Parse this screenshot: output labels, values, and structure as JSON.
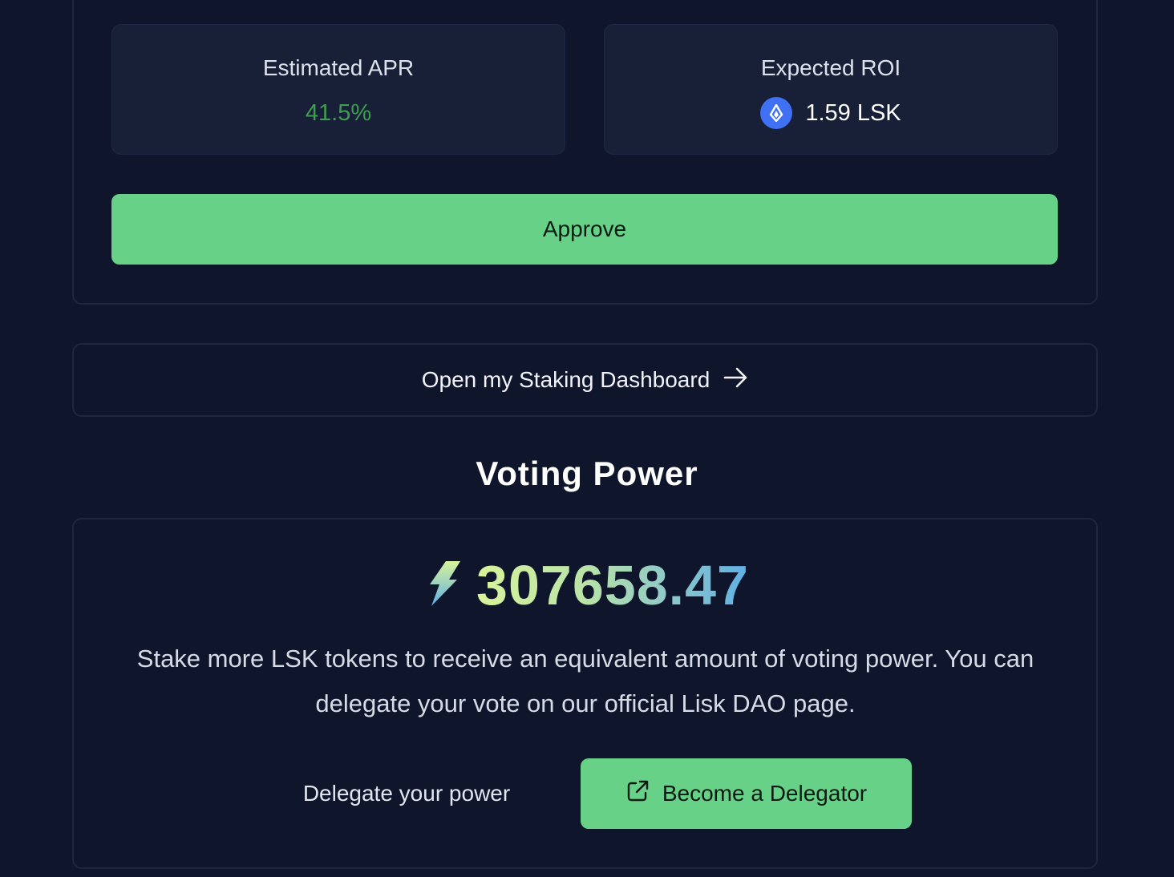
{
  "stats": {
    "apr": {
      "label": "Estimated APR",
      "value": "41.5%",
      "color": "#3f9d4f"
    },
    "roi": {
      "label": "Expected ROI",
      "value": "1.59 LSK",
      "icon": "lsk-token-icon"
    }
  },
  "actions": {
    "approve_label": "Approve",
    "dashboard_label": "Open my Staking Dashboard",
    "dashboard_icon": "arrow-right-icon"
  },
  "voting": {
    "title": "Voting Power",
    "power_value": "307658.47",
    "power_icon": "lightning-bolt-icon",
    "description": "Stake more LSK tokens to receive an equivalent amount of voting power. You can delegate your vote on our official Lisk DAO page.",
    "delegate_label": "Delegate your power",
    "delegator_button_label": "Become a Delegator",
    "delegator_button_icon": "external-link-icon"
  },
  "colors": {
    "background": "#0f152b",
    "accent_green": "#67d287",
    "card_bg": "#182038",
    "lsk_blue": "#4070f4"
  }
}
